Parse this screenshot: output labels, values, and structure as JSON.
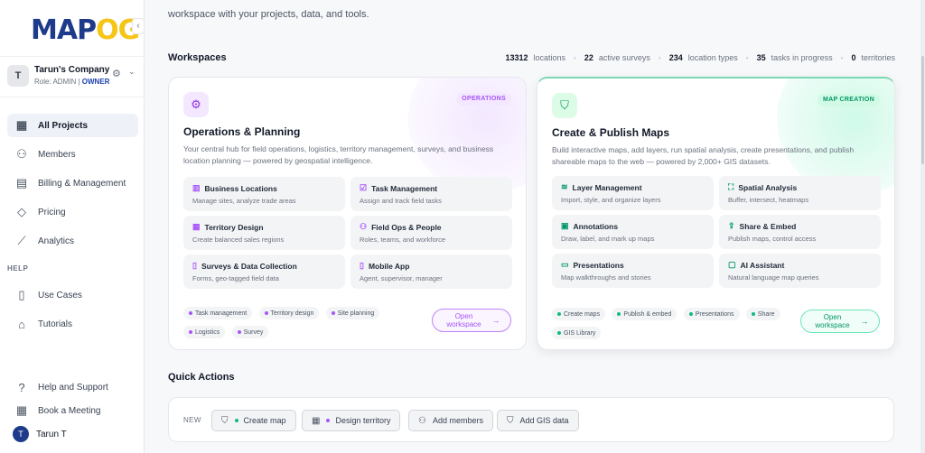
{
  "brand": {
    "logo_main": "MAP",
    "logo_accent": "OG"
  },
  "sidebar": {
    "collapse_icon": "‹",
    "company": {
      "avatar": "T",
      "name": "Tarun's Company",
      "role_prefix": "Role: ADMIN |",
      "role_highlight": "OWNER"
    },
    "items": [
      {
        "label": "All Projects",
        "icon": "grid-icon",
        "glyph": "▦",
        "active": true
      },
      {
        "label": "Members",
        "icon": "user-icon",
        "glyph": "⚇"
      },
      {
        "label": "Billing & Management",
        "icon": "invoice-icon",
        "glyph": "▤"
      },
      {
        "label": "Pricing",
        "icon": "tag-icon",
        "glyph": "◇"
      },
      {
        "label": "Analytics",
        "icon": "trend-icon",
        "glyph": "⟋"
      }
    ],
    "help_section": "HELP",
    "help_items": [
      {
        "label": "Use Cases",
        "icon": "book-icon",
        "glyph": "▯"
      },
      {
        "label": "Tutorials",
        "icon": "graduation-cap-icon",
        "glyph": "⌂"
      }
    ],
    "footer_items": [
      {
        "label": "Help and Support",
        "icon": "help-circle-icon",
        "glyph": "?"
      },
      {
        "label": "Book a Meeting",
        "icon": "calendar-icon",
        "glyph": "▦"
      }
    ],
    "user": {
      "initial": "T",
      "name": "Tarun T"
    }
  },
  "main": {
    "intro": "workspace with your projects, data, and tools.",
    "workspaces_title": "Workspaces",
    "stats": [
      {
        "value": "13312",
        "label": "locations"
      },
      {
        "value": "22",
        "label": "active surveys"
      },
      {
        "value": "234",
        "label": "location types"
      },
      {
        "value": "35",
        "label": "tasks in progress"
      },
      {
        "value": "0",
        "label": "territories"
      }
    ],
    "cards": [
      {
        "badge": "OPERATIONS",
        "icon": "gear-icon",
        "title": "Operations & Planning",
        "description": "Your central hub for field operations, logistics, territory management, surveys, and business location planning — powered by geospatial intelligence.",
        "features": [
          {
            "title": "Business Locations",
            "sub": "Manage sites, analyze trade areas",
            "icon": "building-icon",
            "glyph": "▥"
          },
          {
            "title": "Task Management",
            "sub": "Assign and track field tasks",
            "icon": "checkbox-icon",
            "glyph": "☑"
          },
          {
            "title": "Territory Design",
            "sub": "Create balanced sales regions",
            "icon": "grid-icon",
            "glyph": "▦"
          },
          {
            "title": "Field Ops & People",
            "sub": "Roles, teams, and workforce",
            "icon": "people-icon",
            "glyph": "⚇"
          },
          {
            "title": "Surveys & Data Collection",
            "sub": "Forms, geo-tagged field data",
            "icon": "clipboard-icon",
            "glyph": "▯"
          },
          {
            "title": "Mobile App",
            "sub": "Agent, supervisor, manager",
            "icon": "phone-icon",
            "glyph": "▯"
          }
        ],
        "tags": [
          "Task management",
          "Territory design",
          "Site planning",
          "Logistics",
          "Survey"
        ],
        "button": "Open workspace"
      },
      {
        "badge": "MAP CREATION",
        "icon": "map-icon",
        "title": "Create & Publish Maps",
        "description": "Build interactive maps, add layers, run spatial analysis, create presentations, and publish shareable maps to the web — powered by 2,000+ GIS datasets.",
        "features": [
          {
            "title": "Layer Management",
            "sub": "Import, style, and organize layers",
            "icon": "layers-icon",
            "glyph": "≋"
          },
          {
            "title": "Spatial Analysis",
            "sub": "Buffer, intersect, heatmaps",
            "icon": "scan-icon",
            "glyph": "⛶"
          },
          {
            "title": "Annotations",
            "sub": "Draw, label, and mark up maps",
            "icon": "annotate-icon",
            "glyph": "▣"
          },
          {
            "title": "Share & Embed",
            "sub": "Publish maps, control access",
            "icon": "share-icon",
            "glyph": "⇪"
          },
          {
            "title": "Presentations",
            "sub": "Map walkthroughs and stories",
            "icon": "monitor-icon",
            "glyph": "▭"
          },
          {
            "title": "AI Assistant",
            "sub": "Natural language map queries",
            "icon": "chat-icon",
            "glyph": "▢"
          }
        ],
        "tags": [
          "Create maps",
          "Publish & embed",
          "Presentations",
          "Share",
          "GIS Library"
        ],
        "button": "Open workspace"
      }
    ],
    "quick_actions": {
      "title": "Quick Actions",
      "new_label": "NEW",
      "buttons": [
        {
          "label": "Create map",
          "icon": "map-icon",
          "glyph": "⛉",
          "dot": "#10b981"
        },
        {
          "label": "Design territory",
          "icon": "grid-icon",
          "glyph": "▦",
          "dot": "#a855f7"
        },
        {
          "label": "Add members",
          "icon": "people-icon",
          "glyph": "⚇"
        },
        {
          "label": "Add GIS data",
          "icon": "map-icon",
          "glyph": "⛉"
        }
      ]
    }
  }
}
